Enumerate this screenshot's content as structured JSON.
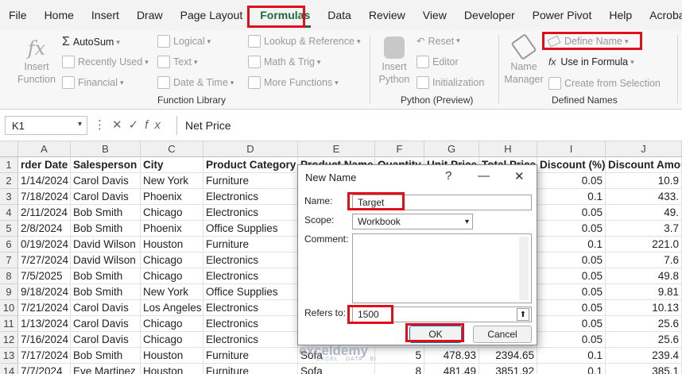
{
  "menu": {
    "tabs": [
      "File",
      "Home",
      "Insert",
      "Draw",
      "Page Layout",
      "Formulas",
      "Data",
      "Review",
      "View",
      "Developer",
      "Power Pivot",
      "Help",
      "Acrobat"
    ],
    "active_index": 5
  },
  "ribbon": {
    "insert_function": "Insert Function",
    "autosum": "AutoSum",
    "recently_used": "Recently Used",
    "financial": "Financial",
    "logical": "Logical",
    "text": "Text",
    "date_time": "Date & Time",
    "lookup_reference": "Lookup & Reference",
    "math_trig": "Math & Trig",
    "more_functions": "More Functions",
    "function_library": "Function Library",
    "insert_python": "Insert Python",
    "reset": "Reset",
    "editor": "Editor",
    "initialization": "Initialization",
    "python_preview": "Python (Preview)",
    "name_manager": "Name Manager",
    "define_name": "Define Name",
    "use_in_formula": "Use in Formula",
    "create_from_selection": "Create from Selection",
    "defined_names": "Defined Names"
  },
  "formula_bar": {
    "name_box": "K1",
    "formula": "Net Price"
  },
  "grid": {
    "columns": [
      "A",
      "B",
      "C",
      "D",
      "E",
      "F",
      "G",
      "H",
      "I",
      "J"
    ],
    "rows": [
      [
        "rder Date",
        "Salesperson",
        "City",
        "Product Category",
        "Product Name",
        "Quantity",
        "Unit Price",
        "Total Price",
        "Discount (%)",
        "Discount Amou"
      ],
      [
        "1/14/2024",
        "Carol Davis",
        "New York",
        "Furniture",
        "",
        "",
        "",
        "",
        "0.05",
        "10.9"
      ],
      [
        "7/18/2024",
        "Carol Davis",
        "Phoenix",
        "Electronics",
        "",
        "",
        "",
        "",
        "0.1",
        "433."
      ],
      [
        "2/11/2024",
        "Bob Smith",
        "Chicago",
        "Electronics",
        "",
        "",
        "",
        "",
        "0.05",
        "49."
      ],
      [
        "2/8/2024",
        "Bob Smith",
        "Phoenix",
        "Office Supplies",
        "",
        "",
        "",
        "",
        "0.05",
        "3.7"
      ],
      [
        "0/19/2024",
        "David Wilson",
        "Houston",
        "Furniture",
        "",
        "",
        "",
        "",
        "0.1",
        "221.0"
      ],
      [
        "7/27/2024",
        "David Wilson",
        "Chicago",
        "Electronics",
        "",
        "",
        "",
        "",
        "0.05",
        "7.6"
      ],
      [
        "7/5/2025",
        "Bob Smith",
        "Chicago",
        "Electronics",
        "",
        "",
        "",
        "",
        "0.05",
        "49.8"
      ],
      [
        "9/18/2024",
        "Bob Smith",
        "New York",
        "Office Supplies",
        "",
        "",
        "",
        "",
        "0.05",
        "9.81"
      ],
      [
        "7/21/2024",
        "Carol Davis",
        "Los Angeles",
        "Electronics",
        "",
        "",
        "",
        "",
        "0.05",
        "10.13"
      ],
      [
        "1/13/2024",
        "Carol Davis",
        "Chicago",
        "Electronics",
        "",
        "",
        "",
        "",
        "0.05",
        "25.6"
      ],
      [
        "7/16/2024",
        "Carol Davis",
        "Chicago",
        "Electronics",
        "",
        "",
        "",
        "",
        "0.05",
        "25.6"
      ],
      [
        "7/17/2024",
        "Bob Smith",
        "Houston",
        "Furniture",
        "Sofa",
        "5",
        "478.93",
        "2394.65",
        "0.1",
        "239.4"
      ],
      [
        "7/7/2024",
        "Eve Martinez",
        "Houston",
        "Furniture",
        "Sofa",
        "8",
        "481.49",
        "3851.92",
        "0.1",
        "385.1"
      ]
    ]
  },
  "dialog": {
    "title": "New Name",
    "name_label": "Name:",
    "name_value": "Target",
    "scope_label": "Scope:",
    "scope_value": "Workbook",
    "comment_label": "Comment:",
    "refers_label": "Refers to:",
    "refers_value": "1500",
    "ok": "OK",
    "cancel": "Cancel"
  },
  "watermark": {
    "brand": "exceldemy",
    "tagline": "EXCEL · DATA · BI"
  }
}
